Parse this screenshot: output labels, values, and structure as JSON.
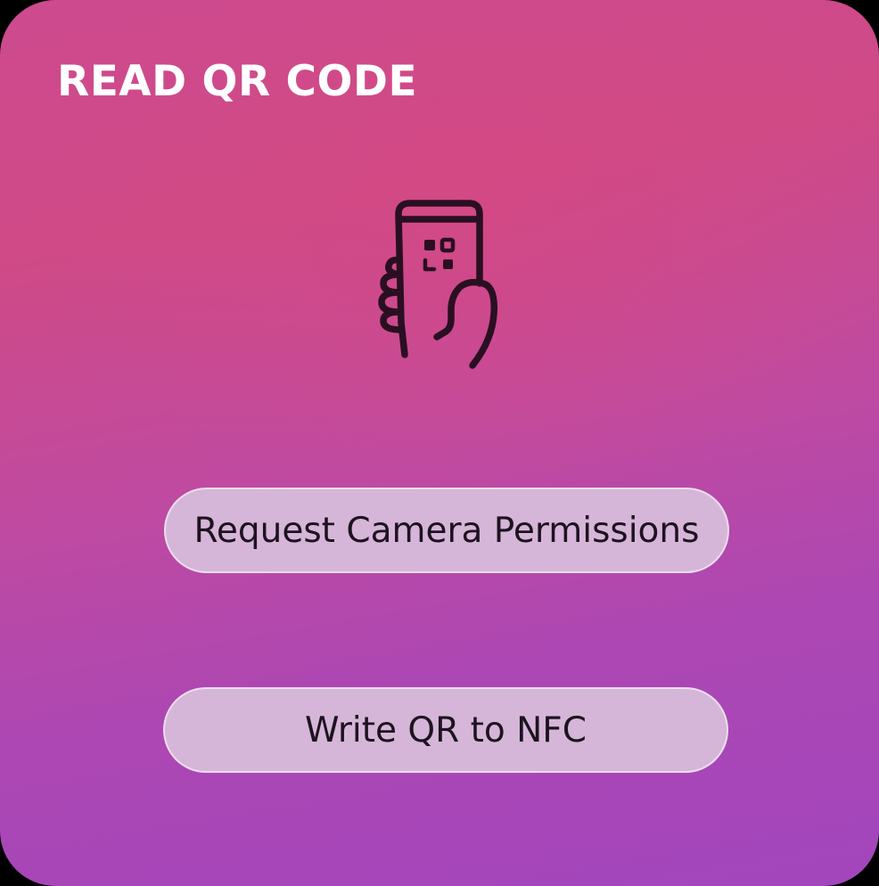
{
  "screen": {
    "title": "READ QR CODE",
    "hero_icon": "hand-holding-phone-qr-icon"
  },
  "actions": {
    "request_camera_label": "Request Camera Permissions",
    "write_nfc_label": "Write QR to NFC"
  },
  "colors": {
    "gradient_top": "#cd4a8f",
    "gradient_bottom": "#a246bd",
    "button_fill": "#d6b6d8",
    "button_text": "#1d1320",
    "icon_stroke": "#2a0f22",
    "title_text": "#ffffff"
  }
}
